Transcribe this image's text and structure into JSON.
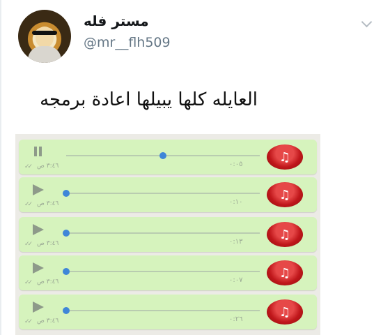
{
  "tweet": {
    "display_name": "مستر فله",
    "handle": "@mr__flh509",
    "text": "العايله كلها يبيلها اعادة برمجه",
    "menu_icon": "chevron-down-icon"
  },
  "voice_notes": [
    {
      "state": "paused",
      "progress": 0.5,
      "duration": "٠:٠٥",
      "time": "٣:٤٦ ص"
    },
    {
      "state": "idle",
      "progress": 0.0,
      "duration": "٠:١٠",
      "time": "٣:٤٦ ص"
    },
    {
      "state": "idle",
      "progress": 0.0,
      "duration": "٠:١٣",
      "time": "٣:٤٦ ص"
    },
    {
      "state": "idle",
      "progress": 0.0,
      "duration": "٠:٠٧",
      "time": "٣:٤٦ ص"
    },
    {
      "state": "idle",
      "progress": 0.0,
      "duration": "٠:٢٦",
      "time": "٣:٤٦ ص"
    }
  ],
  "colors": {
    "bubble": "#d6f3bd",
    "music_button": "#c0171b",
    "progress_knob": "#3f86d8"
  }
}
